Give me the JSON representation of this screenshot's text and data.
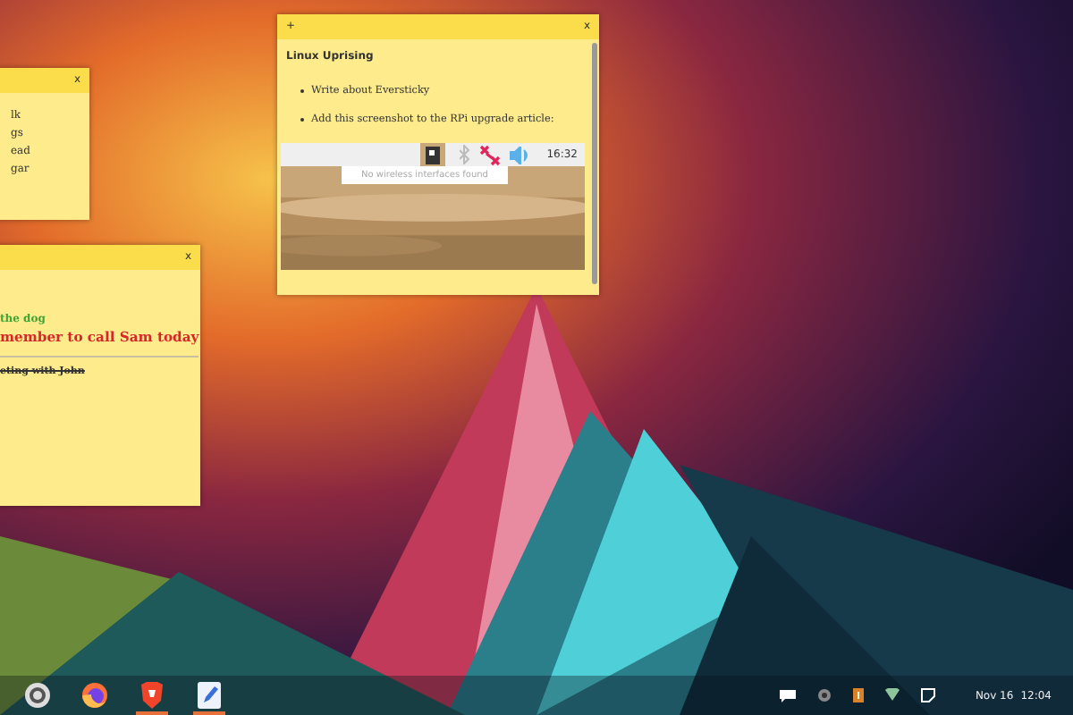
{
  "notes": [
    {
      "close_button": "x",
      "lines": [
        {
          "text": "lk",
          "kind": "plain"
        },
        {
          "text": "gs",
          "kind": "plain"
        },
        {
          "text": "ead",
          "kind": "plain"
        },
        {
          "text": "gar",
          "kind": "plain"
        }
      ]
    },
    {
      "close_button": "x",
      "lines": [
        {
          "text": "the dog",
          "kind": "colored",
          "color": "#3fa535"
        },
        {
          "text": "member to call Sam today",
          "kind": "big",
          "color": "#d8262a"
        },
        {
          "kind": "rule"
        },
        {
          "text": "eting with John",
          "kind": "struck"
        }
      ]
    },
    {
      "add_button": "+",
      "close_button": "x",
      "lines": [
        {
          "text": "Linux Uprising",
          "kind": "title"
        },
        {
          "text": "Write about Eversticky",
          "kind": "bullet"
        },
        {
          "text": "Add this screenshot to the RPi upgrade article:",
          "kind": "bullet"
        },
        {
          "kind": "screenshot",
          "clock": "16:32",
          "tooltip": "No wireless interfaces found"
        }
      ]
    }
  ],
  "taskbar": {
    "apps": [
      {
        "kind": "circle",
        "active": false
      },
      {
        "kind": "firefox",
        "active": false
      },
      {
        "kind": "lion",
        "active": true
      },
      {
        "kind": "editor",
        "active": true
      }
    ],
    "tray": [
      {
        "kind": "chat"
      },
      {
        "kind": "gear"
      },
      {
        "kind": "box"
      },
      {
        "kind": "wifi"
      },
      {
        "kind": "note"
      }
    ],
    "date": "Nov 16",
    "time": "12:04"
  }
}
